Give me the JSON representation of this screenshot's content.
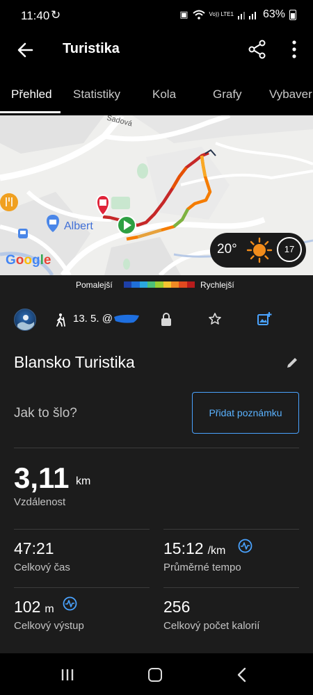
{
  "status_bar": {
    "time": "11:40",
    "network_label": "Vo)) LTE1",
    "battery": "63%"
  },
  "app_bar": {
    "title": "Turistika"
  },
  "tabs": [
    "Přehled",
    "Statistiky",
    "Kola",
    "Grafy",
    "Vybaver"
  ],
  "active_tab": "Přehled",
  "map": {
    "street_label": "Sadová",
    "store_label": "Albert",
    "attribution": "Google",
    "weather": {
      "temperature": "20°",
      "wind": "17"
    },
    "route_colors": [
      "#c62828",
      "#e65100",
      "#f9a825",
      "#7cb342"
    ]
  },
  "speed_legend": {
    "slow_label": "Pomalejší",
    "fast_label": "Rychlejší",
    "colors": [
      "#1e40a8",
      "#1f6fd8",
      "#2aa8e0",
      "#4cbf7a",
      "#9acd32",
      "#f4c430",
      "#f08a24",
      "#e04a1f",
      "#b71c1c"
    ]
  },
  "activity": {
    "date": "13. 5. @",
    "name": "Blansko Turistika",
    "feeling_prompt": "Jak to šlo?",
    "add_note_label": "Přidat poznámku"
  },
  "stats": {
    "distance": {
      "value": "3,11",
      "unit": "km",
      "label": "Vzdálenost"
    },
    "total_time": {
      "value": "47:21",
      "label": "Celkový čas"
    },
    "avg_pace": {
      "value": "15:12",
      "unit": "/km",
      "label": "Průměrné tempo"
    },
    "total_ascent": {
      "value": "102",
      "unit": "m",
      "label": "Celkový výstup"
    },
    "calories": {
      "value": "256",
      "label": "Celkový počet kalorií"
    }
  },
  "colors": {
    "accent": "#4aa3ff",
    "background": "#1c1c1c",
    "start_marker": "#2ea043",
    "end_marker": "#e0243a"
  }
}
